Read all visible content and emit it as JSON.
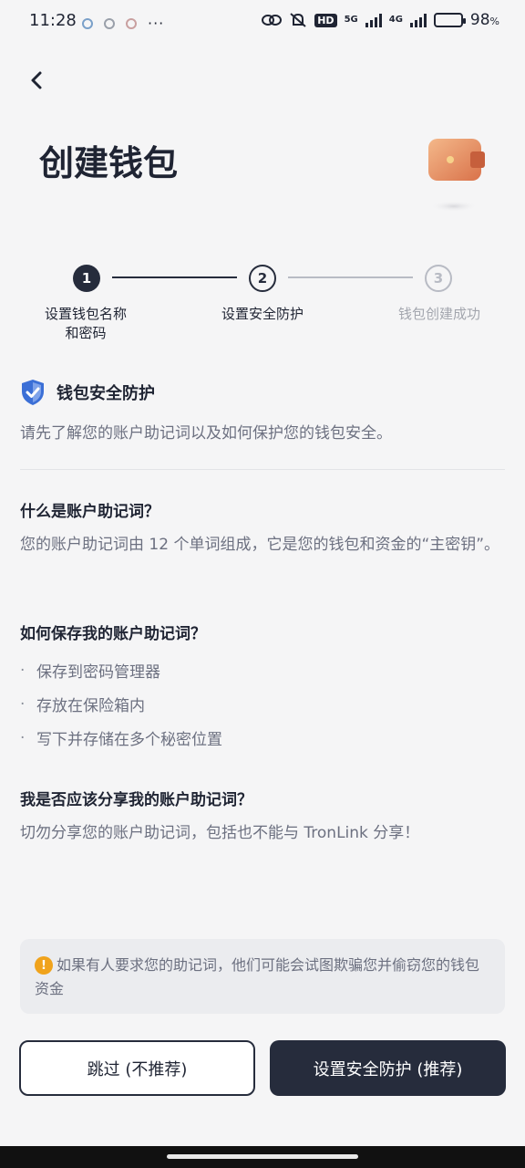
{
  "status_bar": {
    "time": "11:28",
    "more": "···",
    "hd": "HD",
    "net_5g": "5G",
    "net_4g": "4G",
    "battery_level": 0.98,
    "battery": "98"
  },
  "header": {
    "title": "创建钱包"
  },
  "steps": [
    {
      "number": "1",
      "label": "设置钱包名称和密码",
      "state": "active"
    },
    {
      "number": "2",
      "label": "设置安全防护",
      "state": "next"
    },
    {
      "number": "3",
      "label": "钱包创建成功",
      "state": "todo"
    }
  ],
  "security": {
    "title": "钱包安全防护",
    "description": "请先了解您的账户助记词以及如何保护您的钱包安全。"
  },
  "faq": [
    {
      "question": "什么是账户助记词？",
      "answer": "您的账户助记词由 12 个单词组成，它是您的钱包和资金的“主密钥”。"
    },
    {
      "question": "如何保存我的账户助记词？",
      "bullets": [
        "保存到密码管理器",
        "存放在保险箱内",
        "写下并存储在多个秘密位置"
      ]
    },
    {
      "question": "我是否应该分享我的账户助记词？",
      "answer": "切勿分享您的账户助记词，包括也不能与 TronLink 分享！"
    }
  ],
  "bullet_mark": "·",
  "warning": {
    "icon": "!",
    "text": "如果有人要求您的助记词，他们可能会试图欺骗您并偷窃您的钱包资金"
  },
  "buttons": {
    "skip": "跳过 (不推荐)",
    "primary": "设置安全防护 (推荐)"
  },
  "colors": {
    "primary": "#262c3c",
    "background": "#f5f5f6",
    "warning": "#f0a31c",
    "shield": "#3b6fd6"
  }
}
